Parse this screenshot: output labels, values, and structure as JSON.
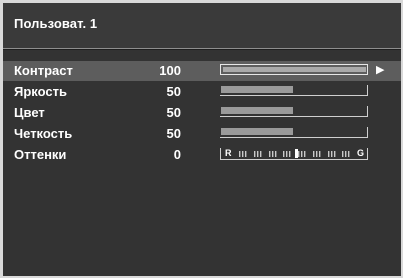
{
  "menu": {
    "title": "Пользоват. 1"
  },
  "items": [
    {
      "label": "Контраст",
      "value": "100",
      "level": 1.0,
      "selected": true
    },
    {
      "label": "Яркость",
      "value": "50",
      "level": 0.5,
      "selected": false
    },
    {
      "label": "Цвет",
      "value": "50",
      "level": 0.5,
      "selected": false
    },
    {
      "label": "Четкость",
      "value": "50",
      "level": 0.5,
      "selected": false
    }
  ],
  "tint": {
    "label": "Оттенки",
    "value": "0",
    "left_end": "R",
    "right_end": "G",
    "level": 0.5
  },
  "icons": {
    "selected_arrow": "right-arrow-icon"
  },
  "colors": {
    "background": "#333333",
    "selected_row": "#5d5d5d",
    "bar_fill": "#9a9a9a",
    "text": "#ffffff"
  }
}
